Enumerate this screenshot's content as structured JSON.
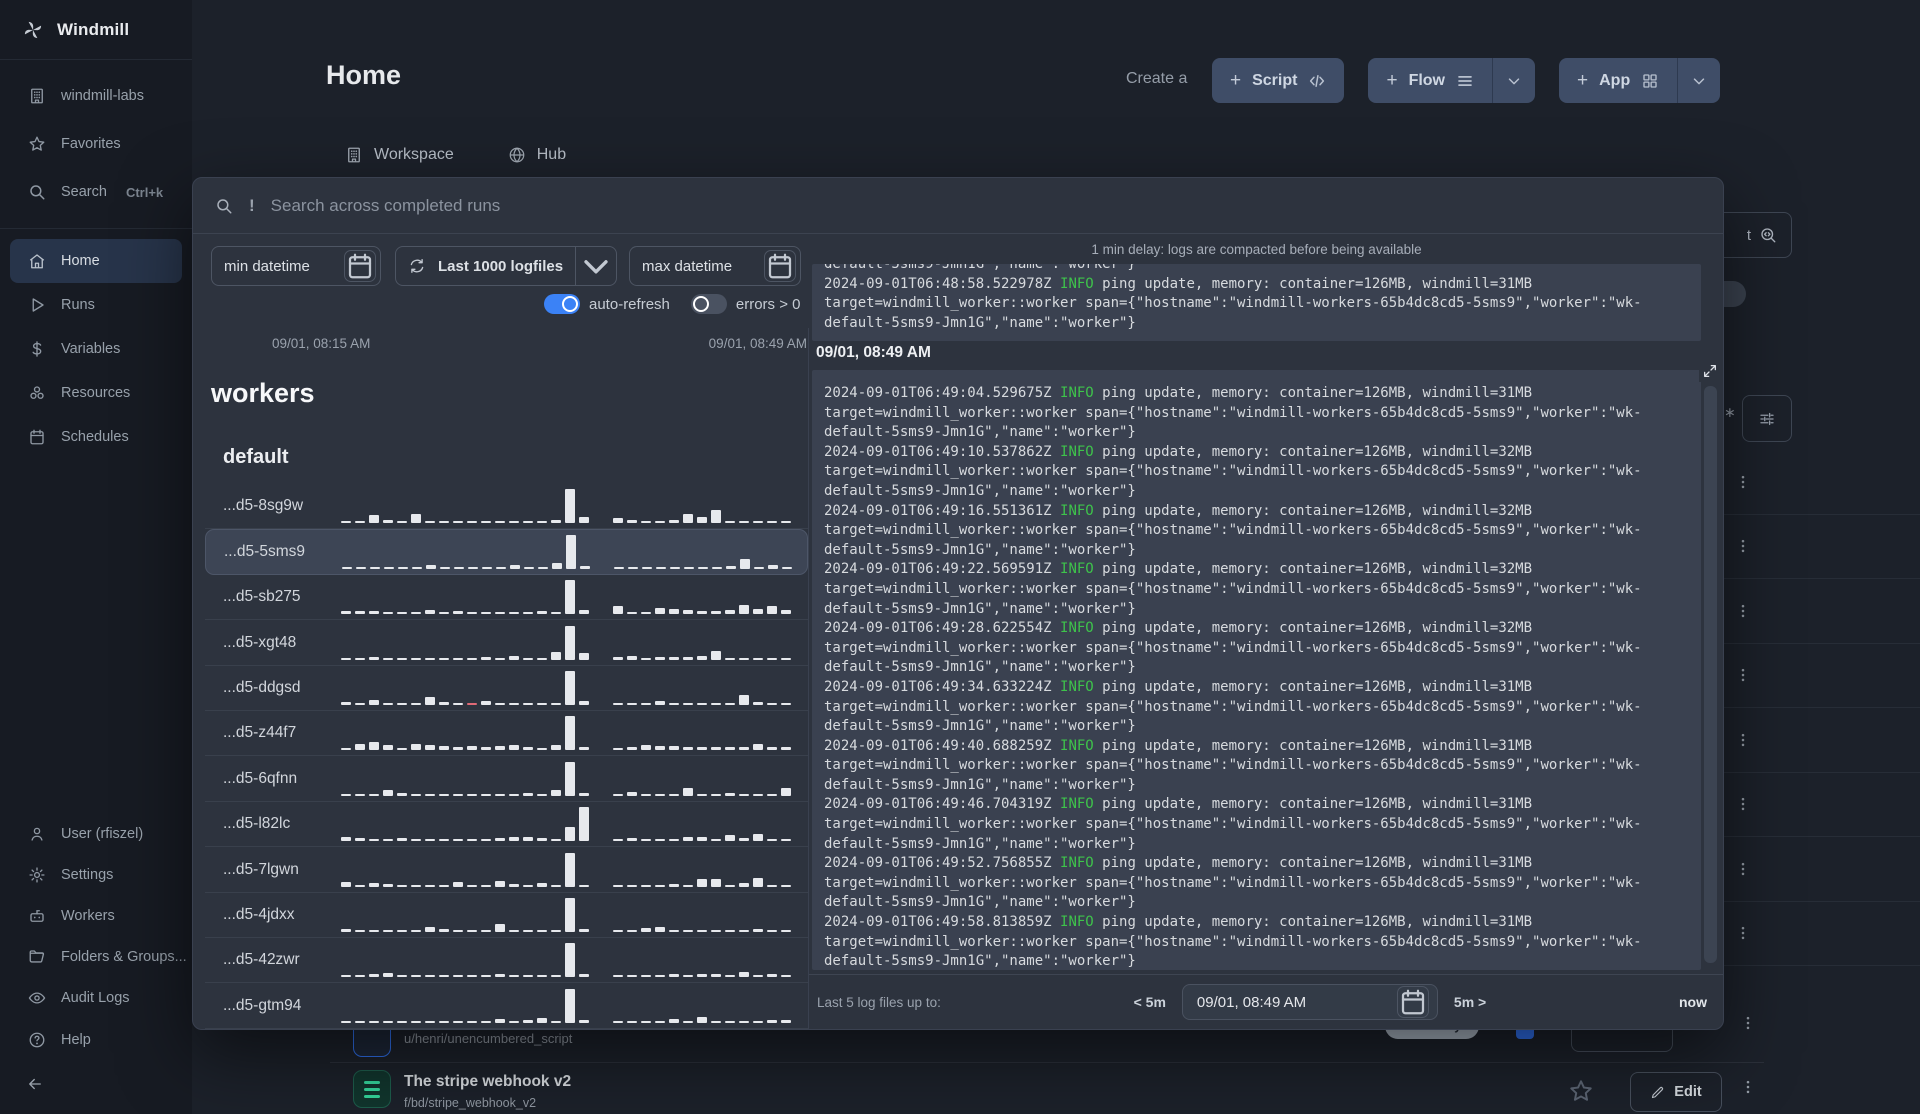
{
  "colors": {
    "accent": "#3b82f6",
    "info_green": "#3ec34b",
    "page_bg": "#1c212a",
    "sidebar_bg": "#171b23",
    "overlay_bg": "#2d333e",
    "log_bg": "#3a4150",
    "button_bg": "#3f4d67"
  },
  "sidebar": {
    "brand": "Windmill",
    "top_items": [
      {
        "id": "workspace",
        "label": "windmill-labs",
        "icon": "building"
      },
      {
        "id": "favorites",
        "label": "Favorites",
        "icon": "star"
      },
      {
        "id": "search",
        "label": "Search",
        "icon": "search",
        "shortcut": "Ctrl+k"
      }
    ],
    "main_items": [
      {
        "id": "home",
        "label": "Home",
        "icon": "home",
        "active": true
      },
      {
        "id": "runs",
        "label": "Runs",
        "icon": "play"
      },
      {
        "id": "variables",
        "label": "Variables",
        "icon": "dollar"
      },
      {
        "id": "resources",
        "label": "Resources",
        "icon": "resources"
      },
      {
        "id": "schedules",
        "label": "Schedules",
        "icon": "calendar"
      }
    ],
    "bottom_items": [
      {
        "id": "user",
        "label": "User (rfiszel)",
        "icon": "person"
      },
      {
        "id": "settings",
        "label": "Settings",
        "icon": "gear"
      },
      {
        "id": "workers",
        "label": "Workers",
        "icon": "bot"
      },
      {
        "id": "folders",
        "label": "Folders & Groups...",
        "icon": "folder"
      },
      {
        "id": "audit-logs",
        "label": "Audit Logs",
        "icon": "eye"
      }
    ],
    "help_label": "Help"
  },
  "header": {
    "title": "Home",
    "create_label": "Create a",
    "buttons": [
      {
        "id": "script",
        "label": "Script",
        "icon": "code",
        "split": false
      },
      {
        "id": "flow",
        "label": "Flow",
        "icon": "menu",
        "split": true
      },
      {
        "id": "app",
        "label": "App",
        "icon": "grid",
        "split": true
      }
    ]
  },
  "tabs": [
    {
      "label": "Workspace",
      "icon": "building"
    },
    {
      "label": "Hub",
      "icon": "globe"
    }
  ],
  "overlay": {
    "search": {
      "prefix": "!",
      "placeholder": "Search across completed runs"
    },
    "filters": {
      "min_label": "min datetime",
      "range_label": "Last 1000 logfiles",
      "max_label": "max datetime"
    },
    "toggles": {
      "auto_refresh": {
        "label": "auto-refresh",
        "on": true
      },
      "errors": {
        "label": "errors > 0",
        "on": false
      }
    },
    "timeline": {
      "start": "09/01, 08:15 AM",
      "end": "09/01, 08:49 AM"
    },
    "workers_title": "workers",
    "group_title": "default",
    "workers": [
      {
        "name": "...d5-8sg9w",
        "selected": false,
        "error_index": null,
        "bars": [
          2,
          2,
          8,
          3,
          2,
          9,
          2,
          2,
          2,
          2,
          2,
          2,
          2,
          2,
          2,
          3,
          34,
          6,
          null,
          5,
          3,
          2,
          2,
          3,
          9,
          6,
          13,
          2,
          2,
          2,
          2,
          2
        ]
      },
      {
        "name": "...d5-5sms9",
        "selected": true,
        "error_index": null,
        "bars": [
          2,
          2,
          2,
          2,
          2,
          2,
          4,
          2,
          2,
          2,
          2,
          2,
          4,
          2,
          2,
          6,
          34,
          3,
          null,
          2,
          2,
          2,
          2,
          2,
          2,
          2,
          2,
          3,
          10,
          2,
          4,
          2
        ]
      },
      {
        "name": "...d5-sb275",
        "selected": false,
        "error_index": null,
        "bars": [
          3,
          3,
          3,
          2,
          2,
          2,
          4,
          2,
          3,
          2,
          2,
          2,
          2,
          2,
          3,
          2,
          34,
          4,
          null,
          8,
          2,
          2,
          6,
          5,
          4,
          3,
          3,
          4,
          9,
          5,
          8,
          4
        ]
      },
      {
        "name": "...d5-xgt48",
        "selected": false,
        "error_index": null,
        "bars": [
          2,
          2,
          3,
          2,
          2,
          2,
          2,
          2,
          2,
          2,
          3,
          2,
          4,
          2,
          2,
          8,
          34,
          7,
          null,
          3,
          4,
          2,
          3,
          3,
          3,
          4,
          9,
          2,
          2,
          2,
          2,
          2
        ]
      },
      {
        "name": "...d5-ddgsd",
        "selected": false,
        "error_index": 9,
        "bars": [
          3,
          2,
          5,
          2,
          2,
          2,
          8,
          3,
          2,
          2,
          4,
          2,
          2,
          2,
          2,
          2,
          34,
          4,
          null,
          2,
          2,
          2,
          4,
          2,
          2,
          2,
          2,
          2,
          10,
          3,
          2,
          2
        ]
      },
      {
        "name": "...d5-z44f7",
        "selected": false,
        "error_index": null,
        "bars": [
          2,
          6,
          8,
          5,
          2,
          6,
          5,
          4,
          3,
          4,
          3,
          4,
          5,
          3,
          2,
          5,
          34,
          3,
          null,
          2,
          3,
          5,
          4,
          4,
          3,
          3,
          3,
          3,
          3,
          6,
          3,
          3
        ]
      },
      {
        "name": "...d5-6qfnn",
        "selected": false,
        "error_index": null,
        "bars": [
          2,
          2,
          2,
          6,
          3,
          2,
          2,
          2,
          2,
          2,
          2,
          2,
          2,
          3,
          2,
          6,
          34,
          3,
          null,
          2,
          4,
          2,
          2,
          2,
          8,
          2,
          2,
          3,
          2,
          2,
          2,
          8
        ]
      },
      {
        "name": "...d5-l82lc",
        "selected": false,
        "error_index": null,
        "bars": [
          4,
          3,
          2,
          2,
          3,
          2,
          2,
          2,
          2,
          2,
          2,
          3,
          4,
          4,
          3,
          2,
          14,
          34,
          null,
          2,
          3,
          2,
          2,
          2,
          4,
          4,
          2,
          6,
          3,
          7,
          2,
          2
        ]
      },
      {
        "name": "...d5-7lgwn",
        "selected": false,
        "error_index": null,
        "bars": [
          5,
          2,
          4,
          3,
          2,
          2,
          2,
          2,
          5,
          2,
          2,
          6,
          3,
          2,
          4,
          2,
          34,
          2,
          null,
          2,
          2,
          2,
          2,
          3,
          2,
          8,
          8,
          2,
          4,
          9,
          2,
          2
        ]
      },
      {
        "name": "...d5-4jdxx",
        "selected": false,
        "error_index": null,
        "bars": [
          3,
          2,
          2,
          2,
          2,
          2,
          5,
          3,
          2,
          2,
          2,
          8,
          2,
          2,
          2,
          2,
          34,
          3,
          null,
          2,
          2,
          4,
          5,
          2,
          2,
          2,
          2,
          2,
          2,
          3,
          2,
          2
        ]
      },
      {
        "name": "...d5-42zwr",
        "selected": false,
        "error_index": null,
        "bars": [
          2,
          2,
          3,
          4,
          2,
          2,
          2,
          2,
          2,
          2,
          2,
          3,
          2,
          2,
          2,
          2,
          34,
          3,
          null,
          2,
          2,
          2,
          2,
          3,
          2,
          3,
          3,
          2,
          5,
          2,
          3,
          2
        ]
      },
      {
        "name": "...d5-gtm94",
        "selected": false,
        "error_index": null,
        "bars": [
          2,
          2,
          2,
          2,
          2,
          2,
          2,
          2,
          2,
          2,
          2,
          4,
          2,
          3,
          5,
          2,
          34,
          3,
          null,
          2,
          2,
          2,
          2,
          4,
          2,
          6,
          2,
          2,
          2,
          2,
          3,
          3
        ]
      }
    ],
    "log": {
      "notice": "1 min delay: logs are compacted before being available",
      "clipped_line": "default-5sms9-Jmn1G\",\"name\":\"worker\"}",
      "level": "INFO",
      "line_mid": " ping update, memory: container=126MB, windmill=",
      "cont1": "target=windmill_worker::worker span={\"hostname\":\"windmill-workers-65b4dc8cd5-5sms9\",\"worker\":\"wk-",
      "cont2": "default-5sms9-Jmn1G\",\"name\":\"worker\"}",
      "prev_entries": [
        {
          "ts": "2024-09-01T06:48:58.522978Z",
          "mem": "31MB"
        }
      ],
      "section_header": "09/01, 08:49 AM",
      "entries": [
        {
          "ts": "2024-09-01T06:49:04.529675Z",
          "mem": "31MB"
        },
        {
          "ts": "2024-09-01T06:49:10.537862Z",
          "mem": "32MB"
        },
        {
          "ts": "2024-09-01T06:49:16.551361Z",
          "mem": "32MB"
        },
        {
          "ts": "2024-09-01T06:49:22.569591Z",
          "mem": "32MB"
        },
        {
          "ts": "2024-09-01T06:49:28.622554Z",
          "mem": "32MB"
        },
        {
          "ts": "2024-09-01T06:49:34.633224Z",
          "mem": "31MB"
        },
        {
          "ts": "2024-09-01T06:49:40.688259Z",
          "mem": "31MB"
        },
        {
          "ts": "2024-09-01T06:49:46.704319Z",
          "mem": "31MB"
        },
        {
          "ts": "2024-09-01T06:49:52.756855Z",
          "mem": "31MB"
        },
        {
          "ts": "2024-09-01T06:49:58.813859Z",
          "mem": "31MB"
        }
      ]
    },
    "footer": {
      "label": "Last 5 log files up to:",
      "back": "< 5m",
      "datetime": "09/01, 08:49 AM",
      "forward": "5m >",
      "now": "now"
    }
  },
  "background": {
    "menu_rows": 8,
    "partial_search_text": "t",
    "script_row": {
      "path": "u/henri/unencumbered_script",
      "badge": "Draft only"
    },
    "webhook_row": {
      "title": "The stripe webhook v2",
      "path": "f/bd/stripe_webhook_v2",
      "edit_label": "Edit"
    }
  }
}
